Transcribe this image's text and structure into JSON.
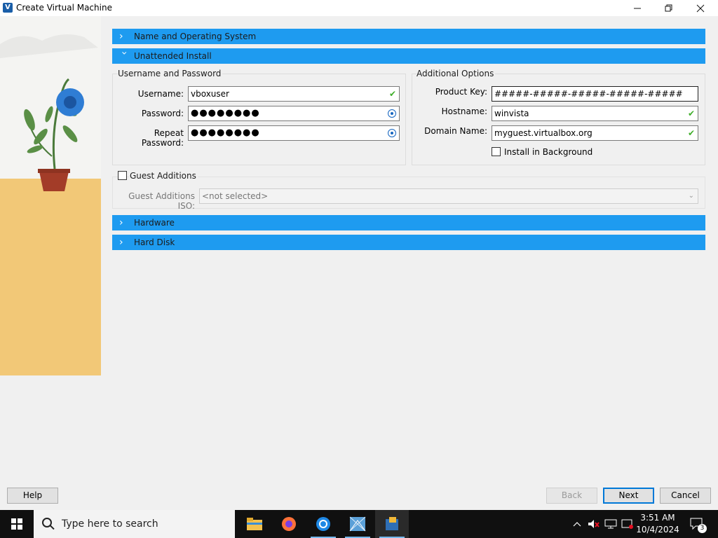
{
  "window": {
    "title": "Create Virtual Machine",
    "icon_text": "V",
    "controls": [
      "minimize-icon",
      "restore-icon",
      "close-icon"
    ]
  },
  "sections": {
    "name_os": "Name and Operating System",
    "unattended": "Unattended Install",
    "hardware": "Hardware",
    "hard_disk": "Hard Disk"
  },
  "user_pass": {
    "group_label": "Username and Password",
    "username_label": "Username:",
    "username_value": "vboxuser",
    "password_label": "Password:",
    "password_value": "●●●●●●●●",
    "repeat_label": "Repeat Password:",
    "repeat_value": "●●●●●●●●"
  },
  "additional": {
    "group_label": "Additional Options",
    "product_key_label": "Product Key:",
    "product_key_value": "#####-#####-#####-#####-#####",
    "hostname_label": "Hostname:",
    "hostname_value": "winvista",
    "domain_label": "Domain Name:",
    "domain_value": "myguest.virtualbox.org",
    "install_bg_label": "Install in Background",
    "install_bg_checked": false
  },
  "guest_additions": {
    "label": "Guest Additions",
    "checked": false,
    "iso_label": "Guest Additions ISO:",
    "iso_value": "<not selected>"
  },
  "buttons": {
    "help": "Help",
    "back": "Back",
    "next": "Next",
    "cancel": "Cancel"
  },
  "taskbar": {
    "search_placeholder": "Type here to search",
    "apps": [
      "file-explorer-icon",
      "firefox-icon",
      "chrome-icon",
      "network-app-icon",
      "virtualbox-icon"
    ],
    "time": "3:51 AM",
    "date": "10/4/2024",
    "notification_count": "3"
  },
  "colors": {
    "section_bar": "#1e9bf0",
    "check_ok": "#3fae2a",
    "primary_border": "#0078d7"
  }
}
